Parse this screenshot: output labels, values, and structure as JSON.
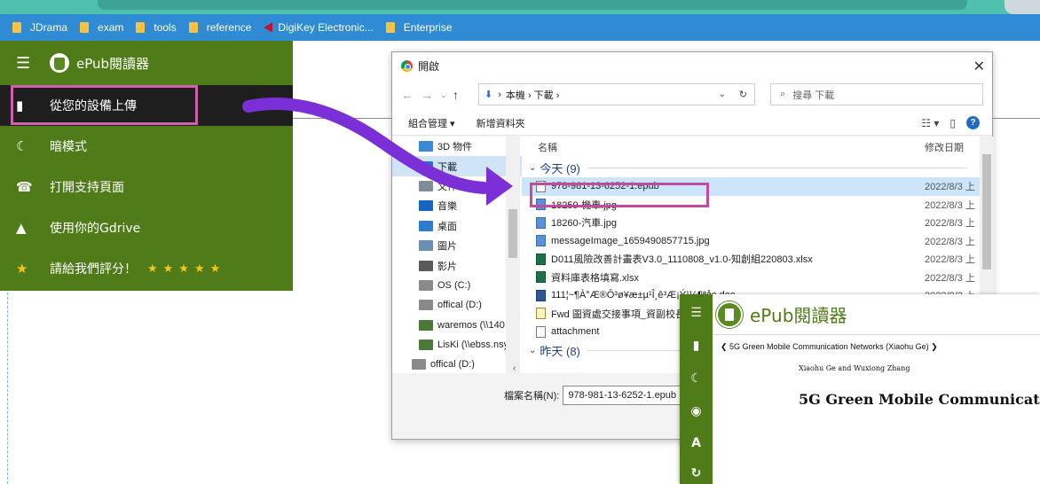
{
  "bookmarks": [
    {
      "label": "JDrama",
      "type": "folder"
    },
    {
      "label": "exam",
      "type": "folder"
    },
    {
      "label": "tools",
      "type": "folder"
    },
    {
      "label": "reference",
      "type": "folder"
    },
    {
      "label": "DigiKey Electronic...",
      "type": "site"
    },
    {
      "label": "Enterprise",
      "type": "folder"
    }
  ],
  "sidebar": {
    "app_title": "ePub閱讀器",
    "items": [
      {
        "label": "從您的設備上傳",
        "icon": "upload-file-icon"
      },
      {
        "label": "暗模式",
        "icon": "moon-icon"
      },
      {
        "label": "打開支持頁面",
        "icon": "support-icon"
      },
      {
        "label": "使用你的Gdrive",
        "icon": "gdrive-icon"
      },
      {
        "label": "請給我們評分！",
        "icon": "star-icon",
        "stars": "★★★★★"
      }
    ]
  },
  "dialog": {
    "title": "開啟",
    "path": "本機 › 下載 ›",
    "search_placeholder": "搜尋 下載",
    "toolbar": {
      "organize": "組合管理 ▾",
      "new_folder": "新增資料夾"
    },
    "tree": [
      {
        "label": "3D 物件",
        "color": "#3b88d8"
      },
      {
        "label": "下載",
        "color": "#2b6cd1"
      },
      {
        "label": "文件",
        "color": "#7f8c9a"
      },
      {
        "label": "音樂",
        "color": "#1565c0"
      },
      {
        "label": "桌面",
        "color": "#2e7bcf"
      },
      {
        "label": "圖片",
        "color": "#6b8fb3"
      },
      {
        "label": "影片",
        "color": "#5a5a5a"
      },
      {
        "label": "OS (C:)",
        "color": "#8a8a8a"
      },
      {
        "label": "offical (D:)",
        "color": "#8a8a8a"
      },
      {
        "label": "waremos (\\\\140",
        "color": "#4a7a3a"
      },
      {
        "label": "LisKi (\\\\ebss.nsy",
        "color": "#4a7a3a"
      },
      {
        "label": "offical (D:)",
        "color": "#8a8a8a"
      }
    ],
    "col_name": "名稱",
    "col_date": "修改日期",
    "group_today": "今天 (9)",
    "group_yesterday": "昨天 (8)",
    "files": [
      {
        "name": "978-981-13-6252-1.epub",
        "date": "2022/8/3 上",
        "kind": "doc-blank",
        "selected": true
      },
      {
        "name": "18259-機車.jpg",
        "date": "2022/8/3 上",
        "kind": "img"
      },
      {
        "name": "18260-汽車.jpg",
        "date": "2022/8/3 上",
        "kind": "img"
      },
      {
        "name": "messageImage_1659490857715.jpg",
        "date": "2022/8/3 上",
        "kind": "img"
      },
      {
        "name": "D011風險改善計畫表V3.0_1110808_v1.0-知創組220803.xlsx",
        "date": "2022/8/3 上",
        "kind": "xls"
      },
      {
        "name": "資料庫表格填寫.xlsx",
        "date": "2022/8/3 上",
        "kind": "xls"
      },
      {
        "name": "111¦~¶À°Æ®Ô³ø¥æ±µ¹Î¸ê³Æ¡Ý¹¼¶ªåc.doc",
        "date": "2022/8/3 上",
        "kind": "doc"
      },
      {
        "name": "Fwd 圖資處交接事項_資副校長",
        "date": "",
        "kind": "msg"
      },
      {
        "name": "attachment",
        "date": "",
        "kind": "doc-blank"
      }
    ],
    "filename_label": "檔案名稱(N):",
    "filename_value": "978-981-13-6252-1.epub"
  },
  "reader": {
    "title": "ePub閱讀器",
    "nav_text": "❮ 5G Green Mobile Communication Networks (Xiaohu Ge) ❯",
    "author": "Xiaohu Ge and Wuxiong Zhang",
    "book_title": "5G Green Mobile Communicati"
  },
  "colors": {
    "sidebar_bg": "#507b19",
    "bookmarks_bg": "#2e8bd4",
    "highlight_border": "#c14b9f",
    "arrow": "#7a30d6"
  }
}
